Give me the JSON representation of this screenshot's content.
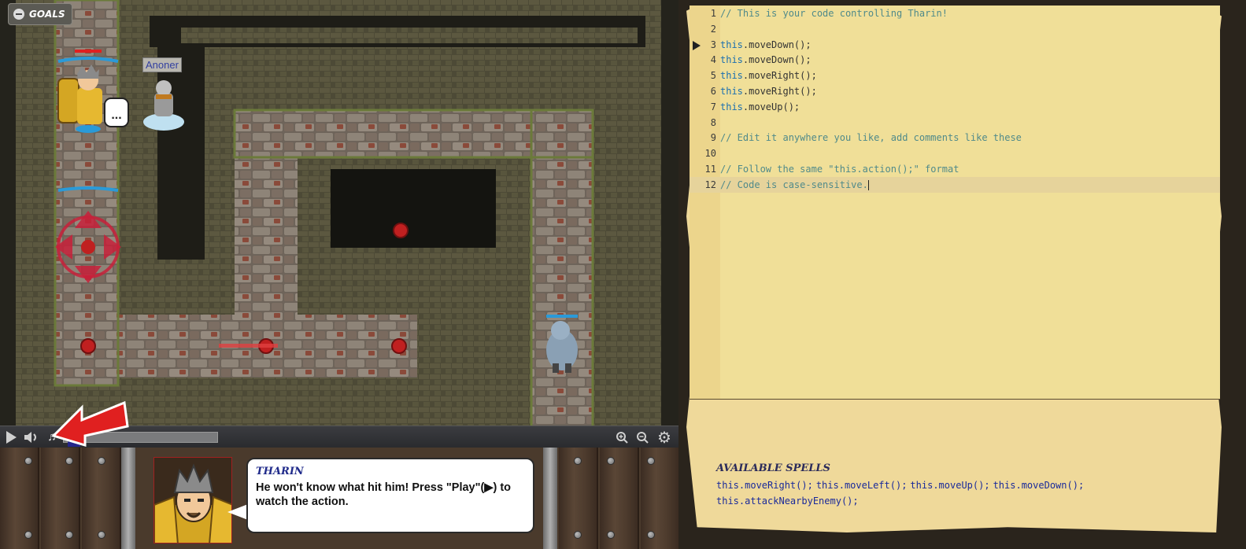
{
  "game": {
    "goals_label": "GOALS",
    "ally_name": "Anoner",
    "hero_speech": "..."
  },
  "controls": {
    "play": "▶",
    "volume": "🔊",
    "music": "♫",
    "zoom_in": "⊕",
    "zoom_out": "⊖",
    "settings": "⚙"
  },
  "dialogue": {
    "speaker": "THARIN",
    "text": "He won't know what hit him! Press \"Play\"(▶) to watch the action."
  },
  "code": {
    "lines": [
      {
        "num": "1",
        "text": "// This is your code controlling Tharin!",
        "kind": "comment"
      },
      {
        "num": "2",
        "text": "",
        "kind": "plain"
      },
      {
        "num": "3",
        "text": "this.moveDown();",
        "kind": "code"
      },
      {
        "num": "4",
        "text": "this.moveDown();",
        "kind": "code"
      },
      {
        "num": "5",
        "text": "this.moveRight();",
        "kind": "code"
      },
      {
        "num": "6",
        "text": "this.moveRight();",
        "kind": "code"
      },
      {
        "num": "7",
        "text": "this.moveUp();",
        "kind": "code"
      },
      {
        "num": "8",
        "text": "",
        "kind": "plain"
      },
      {
        "num": "9",
        "text": "// Edit it anywhere you like, add comments like these",
        "kind": "comment"
      },
      {
        "num": "10",
        "text": "",
        "kind": "plain"
      },
      {
        "num": "11",
        "text": "// Follow the same \"this.action();\" format",
        "kind": "comment"
      },
      {
        "num": "12",
        "text": "// Code is case-sensitive.",
        "kind": "comment"
      }
    ]
  },
  "spells": {
    "title": "AVAILABLE SPELLS",
    "items": [
      "this.moveRight();",
      "this.moveLeft();",
      "this.moveUp();",
      "this.moveDown();",
      "this.attackNearbyEnemy();"
    ]
  },
  "colors": {
    "parchment": "#efd99a",
    "comment": "#508a8a",
    "keyword": "#1a6fb0",
    "spell": "#1a2a9a",
    "arrow_red": "#e02020"
  }
}
